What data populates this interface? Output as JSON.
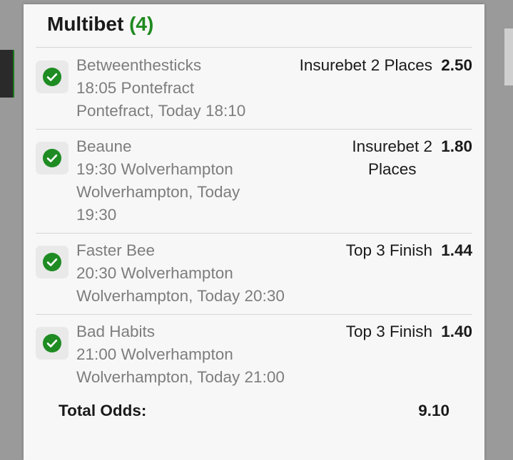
{
  "multibet": {
    "title": "Multibet",
    "count": "(4)"
  },
  "colors": {
    "accent_green": "#1f8a1f",
    "check_green": "#1e8c22"
  },
  "selections": [
    {
      "icon": "check-circle-icon",
      "horse": "Betweenthesticks",
      "race": "18:05 Pontefract",
      "venue_line1": "Pontefract, Today 18:10",
      "venue_line2": "",
      "market_line1": "Insurebet 2 Places",
      "market_line2": "",
      "odds": "2.50"
    },
    {
      "icon": "check-circle-icon",
      "horse": "Beaune",
      "race": "19:30 Wolverhampton",
      "venue_line1": "Wolverhampton, Today",
      "venue_line2": "19:30",
      "market_line1": "Insurebet 2",
      "market_line2": "Places",
      "odds": "1.80"
    },
    {
      "icon": "check-circle-icon",
      "horse": "Faster Bee",
      "race": "20:30 Wolverhampton",
      "venue_line1": "Wolverhampton, Today 20:30",
      "venue_line2": "",
      "market_line1": "Top 3 Finish",
      "market_line2": "",
      "odds": "1.44"
    },
    {
      "icon": "check-circle-icon",
      "horse": "Bad Habits",
      "race": "21:00 Wolverhampton",
      "venue_line1": "Wolverhampton, Today 21:00",
      "venue_line2": "",
      "market_line1": "Top 3 Finish",
      "market_line2": "",
      "odds": "1.40"
    }
  ],
  "total": {
    "label": "Total Odds:",
    "value": "9.10"
  }
}
